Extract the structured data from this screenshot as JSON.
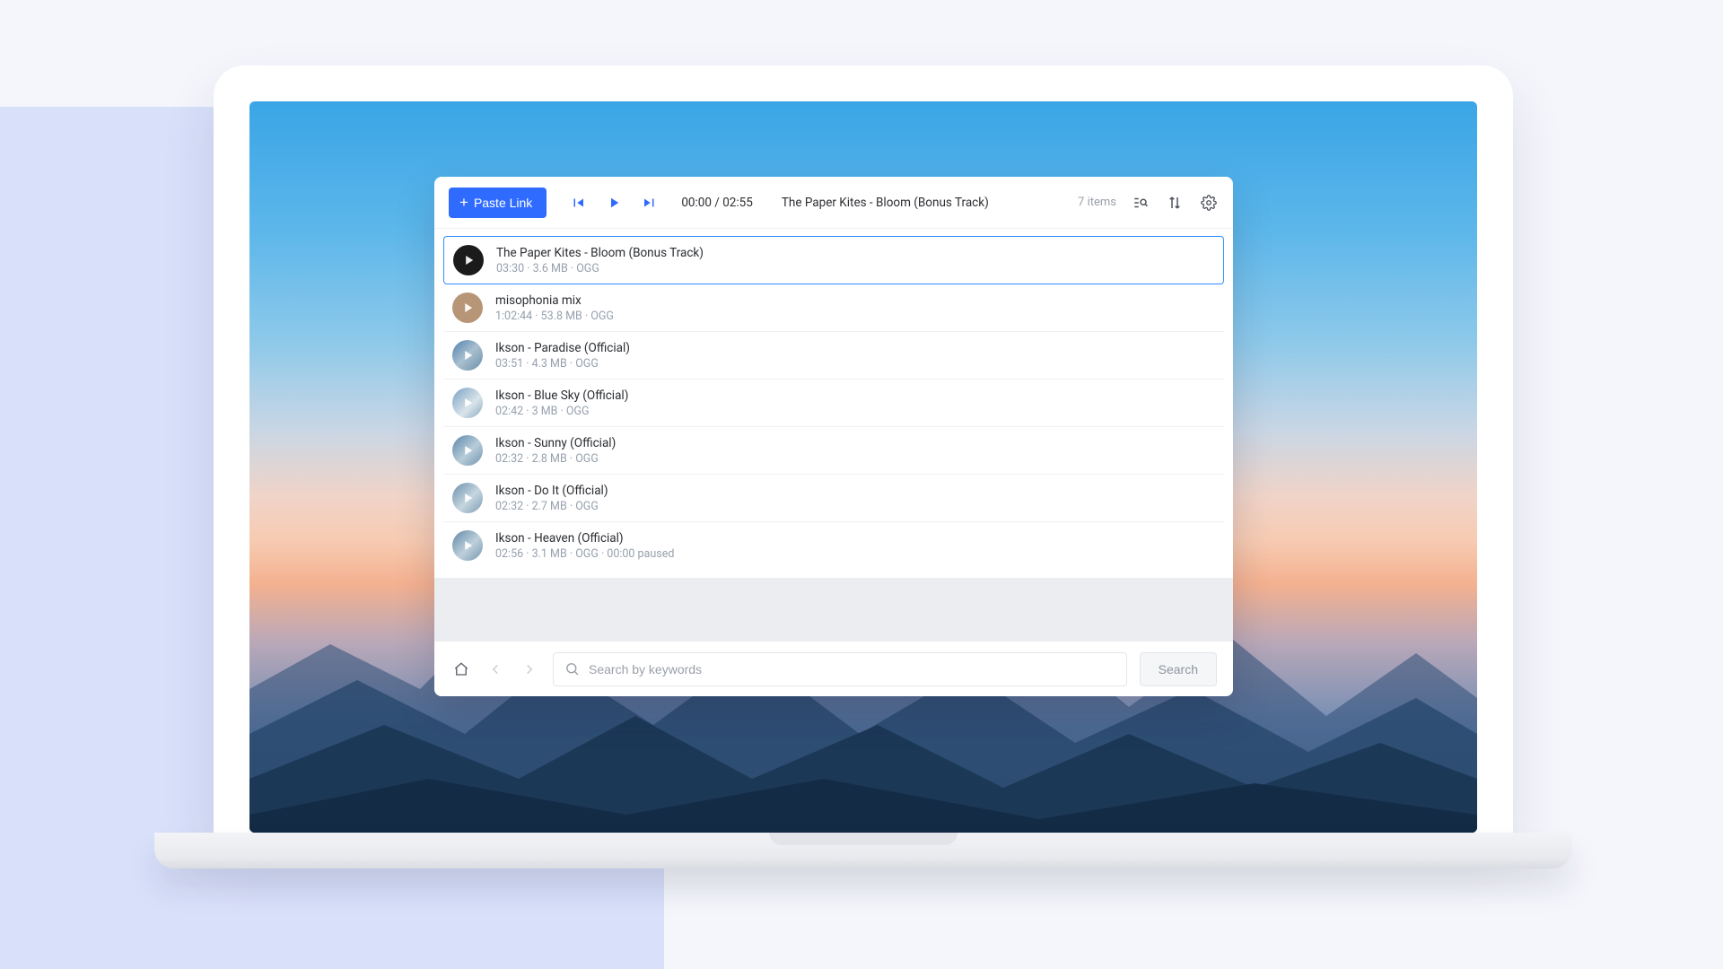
{
  "toolbar": {
    "paste_label": "Paste Link",
    "time": "00:00 / 02:55",
    "now_playing": "The Paper Kites - Bloom (Bonus Track)",
    "items_count": "7 items"
  },
  "tracks": [
    {
      "title": "The Paper Kites - Bloom (Bonus Track)",
      "sub": "03:30 · 3.6 MB · OGG",
      "thumb": "dark",
      "active": true
    },
    {
      "title": "misophonia mix",
      "sub": "1:02:44 · 53.8 MB · OGG",
      "thumb": "tan",
      "active": false
    },
    {
      "title": "Ikson - Paradise (Official)",
      "sub": "03:51 · 4.3 MB · OGG",
      "thumb": "photo1",
      "active": false
    },
    {
      "title": "Ikson - Blue Sky (Official)",
      "sub": "02:42 · 3 MB · OGG",
      "thumb": "photo2",
      "active": false
    },
    {
      "title": "Ikson - Sunny (Official)",
      "sub": "02:32 · 2.8 MB · OGG",
      "thumb": "photo3",
      "active": false
    },
    {
      "title": "Ikson - Do It (Official)",
      "sub": "02:32 · 2.7 MB · OGG",
      "thumb": "photo4",
      "active": false
    },
    {
      "title": "Ikson - Heaven (Official)",
      "sub": "02:56 · 3.1 MB · OGG · 00:00 paused",
      "thumb": "photo5",
      "active": false
    }
  ],
  "footer": {
    "search_placeholder": "Search by keywords",
    "search_button": "Search"
  }
}
